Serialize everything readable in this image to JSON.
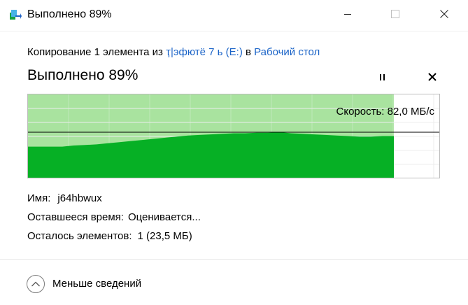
{
  "window": {
    "title": "Выполнено 89%",
    "icons": {
      "app": "copy-files-icon",
      "minimize": "minimize-icon",
      "maximize": "maximize-icon",
      "close": "close-icon"
    }
  },
  "operation": {
    "prefix": "Копирование 1 элемента из ",
    "source": "ҭ|эфютё 7 ь (E:)",
    "middle": " в ",
    "destination": "Рабочий стол"
  },
  "progress": {
    "title": "Выполнено 89%",
    "percent": 89,
    "pause_icon": "pause-icon",
    "cancel_icon": "cancel-icon"
  },
  "speed": {
    "label": "Скорость: 82,0 МБ/с"
  },
  "details": {
    "name_label": "Имя:",
    "name_value": "j64hbwux",
    "time_label": "Оставшееся время:",
    "time_value": "Оценивается...",
    "items_label": "Осталось элементов:",
    "items_value": "1 (23,5 МБ)"
  },
  "footer": {
    "less_label": "Меньше сведений",
    "less_icon": "chevron-up-icon"
  },
  "colors": {
    "accent_link": "#1a63c7",
    "graph_fill": "#06b025",
    "graph_progress_bg": "#a9e39f",
    "graph_grid": "#c9eec3"
  },
  "chart_data": {
    "type": "area",
    "x_label": "",
    "y_label": "",
    "speed_line_mbps": 82.0,
    "progress_fraction": 0.89,
    "values": [
      56,
      56,
      56,
      56,
      58,
      59,
      60,
      62,
      64,
      66,
      68,
      70,
      72,
      74,
      76,
      77,
      78,
      79,
      80,
      80,
      81,
      81,
      82,
      80,
      79,
      78,
      77,
      76,
      75,
      74,
      74,
      75,
      75
    ]
  }
}
